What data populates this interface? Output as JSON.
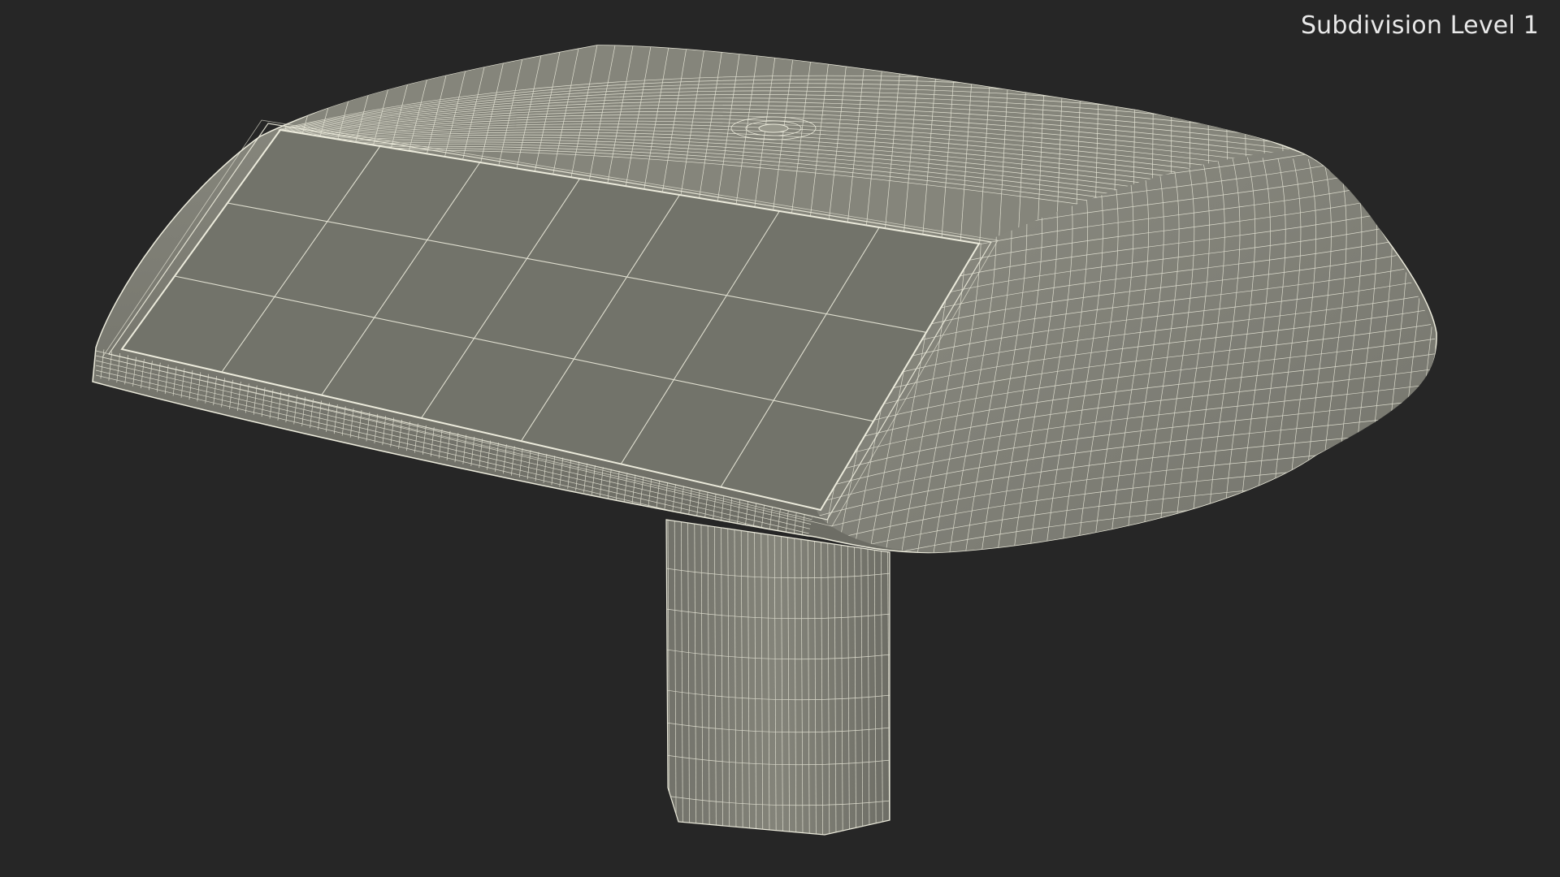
{
  "viewport": {
    "label": "Subdivision Level 1",
    "background_color": "#262626"
  },
  "model": {
    "render_style": "wireframe-on-shaded",
    "surface_color": "#7c7c72",
    "panel_color": "#72736a",
    "wire_color": "#ecebdc"
  }
}
